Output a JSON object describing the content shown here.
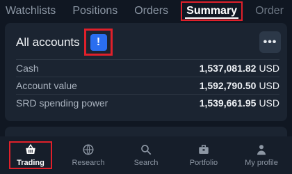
{
  "tabs": [
    {
      "label": "Watchlists"
    },
    {
      "label": "Positions"
    },
    {
      "label": "Orders"
    },
    {
      "label": "Summary"
    },
    {
      "label": "Order"
    }
  ],
  "account_card": {
    "title": "All accounts",
    "alert_symbol": "!",
    "more_symbol": "•••",
    "rows": [
      {
        "label": "Cash",
        "value": "1,537,081.82",
        "currency": "USD"
      },
      {
        "label": "Account value",
        "value": "1,592,790.50",
        "currency": "USD"
      },
      {
        "label": "SRD spending power",
        "value": "1,539,661.95",
        "currency": "USD"
      }
    ]
  },
  "bottom_nav": [
    {
      "label": "Trading",
      "icon": "basket-icon"
    },
    {
      "label": "Research",
      "icon": "globe-icon"
    },
    {
      "label": "Search",
      "icon": "search-icon"
    },
    {
      "label": "Portfolio",
      "icon": "briefcase-icon"
    },
    {
      "label": "My profile",
      "icon": "person-icon"
    }
  ],
  "colors": {
    "background": "#101722",
    "card": "#1b2431",
    "accent_blue": "#2a6ef0",
    "highlight_red": "#e0202a"
  }
}
